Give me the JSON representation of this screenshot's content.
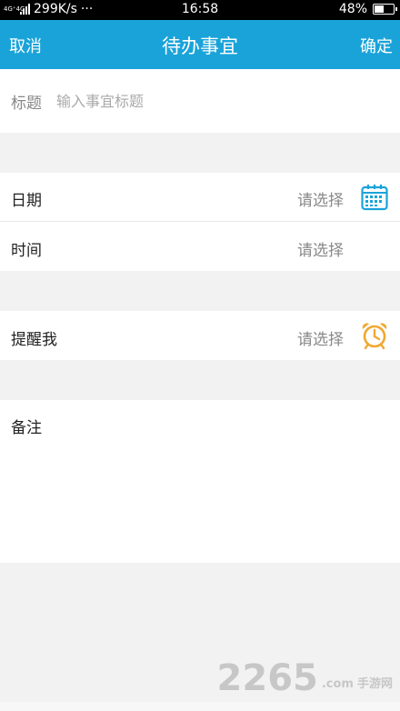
{
  "status_bar": {
    "network": "4G⁺4G",
    "speed": "299K/s",
    "dots": "···",
    "time": "16:58",
    "battery": "48%",
    "battery_level": 0.48
  },
  "nav": {
    "cancel": "取消",
    "title": "待办事宜",
    "confirm": "确定"
  },
  "form": {
    "title_label": "标题",
    "title_placeholder": "输入事宜标题",
    "date_label": "日期",
    "date_value": "请选择",
    "time_label": "时间",
    "time_value": "请选择",
    "remind_label": "提醒我",
    "remind_value": "请选择",
    "note_label": "备注"
  },
  "icons": {
    "calendar": "calendar-icon",
    "alarm": "alarm-clock-icon"
  },
  "colors": {
    "accent": "#1aa3d9",
    "alarm": "#f0a830"
  },
  "watermark": {
    "number": "2265",
    "suffix": ".com",
    "text": "手游网"
  }
}
